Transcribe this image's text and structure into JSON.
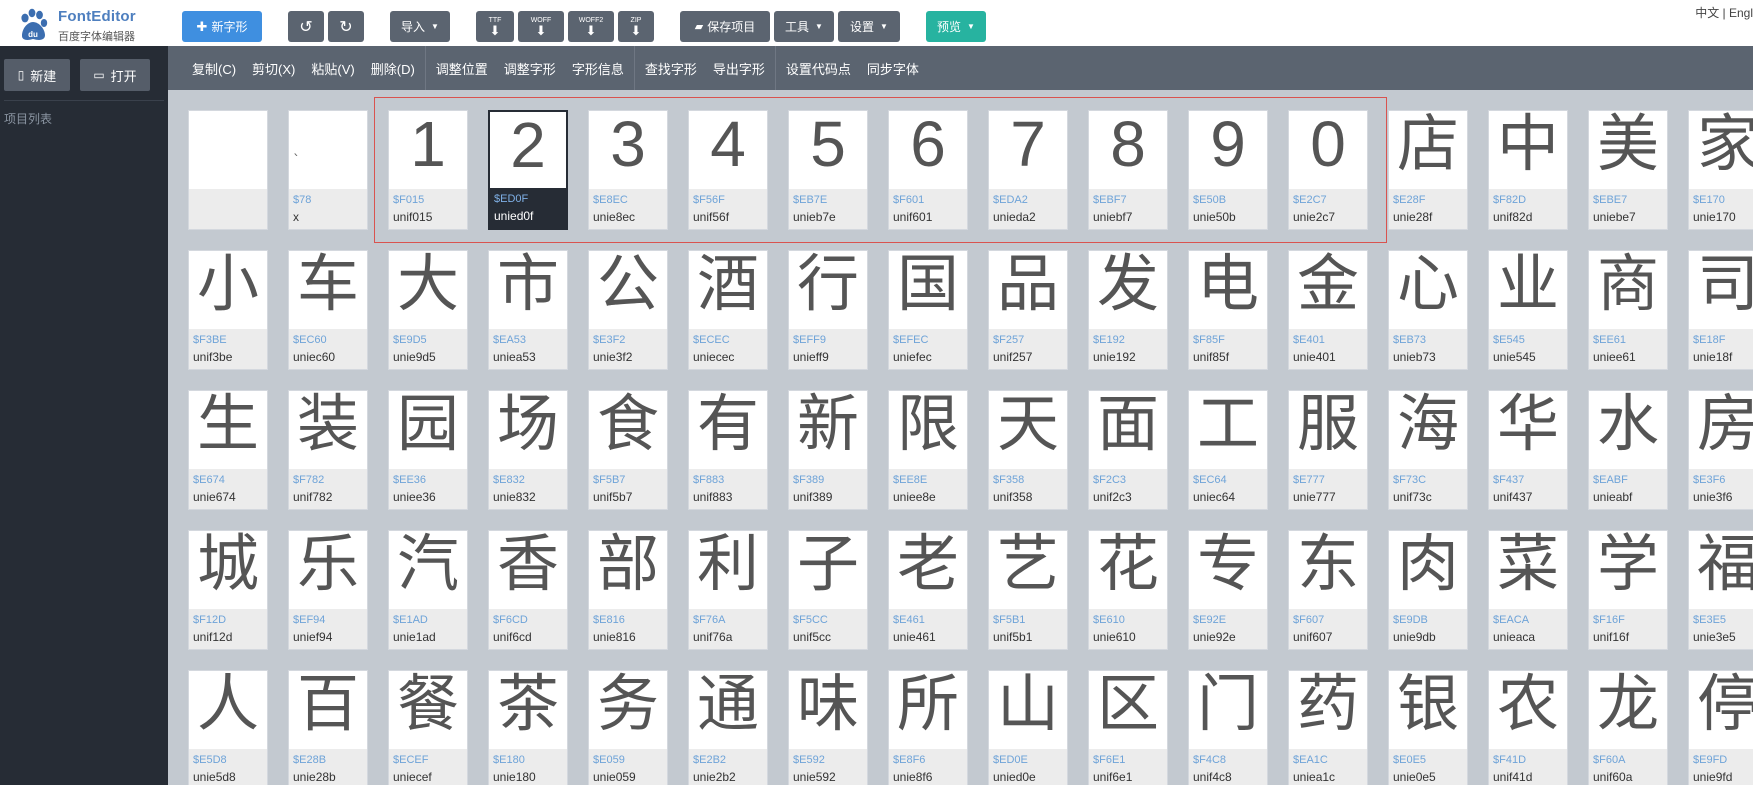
{
  "header": {
    "logo_title": "FontEditor",
    "logo_sub": "百度字体编辑器",
    "buttons": {
      "new_glyph": "新字形",
      "import": "导入",
      "ttf": "TTF",
      "woff": "WOFF",
      "woff2": "WOFF2",
      "zip": "ZIP",
      "save": "保存项目",
      "tools": "工具",
      "settings": "设置",
      "preview": "预览"
    },
    "lang": "中文 | Engl"
  },
  "sidebar": {
    "new_label": "新建",
    "open_label": "打开",
    "project_list": "项目列表"
  },
  "toolbar": {
    "copy": "复制(C)",
    "cut": "剪切(X)",
    "paste": "粘贴(V)",
    "delete": "删除(D)",
    "adjust_pos": "调整位置",
    "adjust_glyph": "调整字形",
    "glyph_info": "字形信息",
    "find_glyph": "查找字形",
    "export_glyph": "导出字形",
    "set_codepoint": "设置代码点",
    "sync_font": "同步字体"
  },
  "glyphs": [
    {
      "g": "",
      "code": "",
      "name": ""
    },
    {
      "g": "`",
      "code": "$78",
      "name": "x"
    },
    {
      "g": "1",
      "code": "$F015",
      "name": "unif015"
    },
    {
      "g": "2",
      "code": "$ED0F",
      "name": "unied0f"
    },
    {
      "g": "3",
      "code": "$E8EC",
      "name": "unie8ec"
    },
    {
      "g": "4",
      "code": "$F56F",
      "name": "unif56f"
    },
    {
      "g": "5",
      "code": "$EB7E",
      "name": "unieb7e"
    },
    {
      "g": "6",
      "code": "$F601",
      "name": "unif601"
    },
    {
      "g": "7",
      "code": "$EDA2",
      "name": "unieda2"
    },
    {
      "g": "8",
      "code": "$EBF7",
      "name": "uniebf7"
    },
    {
      "g": "9",
      "code": "$E50B",
      "name": "unie50b"
    },
    {
      "g": "0",
      "code": "$E2C7",
      "name": "unie2c7"
    },
    {
      "g": "店",
      "code": "$E28F",
      "name": "unie28f"
    },
    {
      "g": "中",
      "code": "$F82D",
      "name": "unif82d"
    },
    {
      "g": "美",
      "code": "$EBE7",
      "name": "uniebe7"
    },
    {
      "g": "家",
      "code": "$E170",
      "name": "unie170"
    },
    {
      "g": "小",
      "code": "$F3BE",
      "name": "unif3be"
    },
    {
      "g": "车",
      "code": "$EC60",
      "name": "uniec60"
    },
    {
      "g": "大",
      "code": "$E9D5",
      "name": "unie9d5"
    },
    {
      "g": "市",
      "code": "$EA53",
      "name": "uniea53"
    },
    {
      "g": "公",
      "code": "$E3F2",
      "name": "unie3f2"
    },
    {
      "g": "酒",
      "code": "$ECEC",
      "name": "uniecec"
    },
    {
      "g": "行",
      "code": "$EFF9",
      "name": "unieff9"
    },
    {
      "g": "国",
      "code": "$EFEC",
      "name": "uniefec"
    },
    {
      "g": "品",
      "code": "$F257",
      "name": "unif257"
    },
    {
      "g": "发",
      "code": "$E192",
      "name": "unie192"
    },
    {
      "g": "电",
      "code": "$F85F",
      "name": "unif85f"
    },
    {
      "g": "金",
      "code": "$E401",
      "name": "unie401"
    },
    {
      "g": "心",
      "code": "$EB73",
      "name": "unieb73"
    },
    {
      "g": "业",
      "code": "$E545",
      "name": "unie545"
    },
    {
      "g": "商",
      "code": "$EE61",
      "name": "uniee61"
    },
    {
      "g": "司",
      "code": "$E18F",
      "name": "unie18f"
    },
    {
      "g": "生",
      "code": "$E674",
      "name": "unie674"
    },
    {
      "g": "装",
      "code": "$F782",
      "name": "unif782"
    },
    {
      "g": "园",
      "code": "$EE36",
      "name": "uniee36"
    },
    {
      "g": "场",
      "code": "$E832",
      "name": "unie832"
    },
    {
      "g": "食",
      "code": "$F5B7",
      "name": "unif5b7"
    },
    {
      "g": "有",
      "code": "$F883",
      "name": "unif883"
    },
    {
      "g": "新",
      "code": "$F389",
      "name": "unif389"
    },
    {
      "g": "限",
      "code": "$EE8E",
      "name": "uniee8e"
    },
    {
      "g": "天",
      "code": "$F358",
      "name": "unif358"
    },
    {
      "g": "面",
      "code": "$F2C3",
      "name": "unif2c3"
    },
    {
      "g": "工",
      "code": "$EC64",
      "name": "uniec64"
    },
    {
      "g": "服",
      "code": "$E777",
      "name": "unie777"
    },
    {
      "g": "海",
      "code": "$F73C",
      "name": "unif73c"
    },
    {
      "g": "华",
      "code": "$F437",
      "name": "unif437"
    },
    {
      "g": "水",
      "code": "$EABF",
      "name": "unieabf"
    },
    {
      "g": "房",
      "code": "$E3F6",
      "name": "unie3f6"
    },
    {
      "g": "城",
      "code": "$F12D",
      "name": "unif12d"
    },
    {
      "g": "乐",
      "code": "$EF94",
      "name": "unief94"
    },
    {
      "g": "汽",
      "code": "$E1AD",
      "name": "unie1ad"
    },
    {
      "g": "香",
      "code": "$F6CD",
      "name": "unif6cd"
    },
    {
      "g": "部",
      "code": "$E816",
      "name": "unie816"
    },
    {
      "g": "利",
      "code": "$F76A",
      "name": "unif76a"
    },
    {
      "g": "子",
      "code": "$F5CC",
      "name": "unif5cc"
    },
    {
      "g": "老",
      "code": "$E461",
      "name": "unie461"
    },
    {
      "g": "艺",
      "code": "$F5B1",
      "name": "unif5b1"
    },
    {
      "g": "花",
      "code": "$E610",
      "name": "unie610"
    },
    {
      "g": "专",
      "code": "$E92E",
      "name": "unie92e"
    },
    {
      "g": "东",
      "code": "$F607",
      "name": "unif607"
    },
    {
      "g": "肉",
      "code": "$E9DB",
      "name": "unie9db"
    },
    {
      "g": "菜",
      "code": "$EACA",
      "name": "unieaca"
    },
    {
      "g": "学",
      "code": "$F16F",
      "name": "unif16f"
    },
    {
      "g": "福",
      "code": "$E3E5",
      "name": "unie3e5"
    },
    {
      "g": "人",
      "code": "$E5D8",
      "name": "unie5d8"
    },
    {
      "g": "百",
      "code": "$E28B",
      "name": "unie28b"
    },
    {
      "g": "餐",
      "code": "$ECEF",
      "name": "uniecef"
    },
    {
      "g": "茶",
      "code": "$E180",
      "name": "unie180"
    },
    {
      "g": "务",
      "code": "$E059",
      "name": "unie059"
    },
    {
      "g": "通",
      "code": "$E2B2",
      "name": "unie2b2"
    },
    {
      "g": "味",
      "code": "$E592",
      "name": "unie592"
    },
    {
      "g": "所",
      "code": "$E8F6",
      "name": "unie8f6"
    },
    {
      "g": "山",
      "code": "$ED0E",
      "name": "unied0e"
    },
    {
      "g": "区",
      "code": "$F6E1",
      "name": "unif6e1"
    },
    {
      "g": "门",
      "code": "$F4C8",
      "name": "unif4c8"
    },
    {
      "g": "药",
      "code": "$EA1C",
      "name": "uniea1c"
    },
    {
      "g": "银",
      "code": "$E0E5",
      "name": "unie0e5"
    },
    {
      "g": "农",
      "code": "$F41D",
      "name": "unif41d"
    },
    {
      "g": "龙",
      "code": "$F60A",
      "name": "unif60a"
    },
    {
      "g": "停",
      "code": "$E9FD",
      "name": "unie9fd"
    }
  ],
  "selected_code": "$ED0F",
  "colors": {
    "accent_blue": "#3f8fe0",
    "preview_teal": "#27b3a0",
    "sidebar": "#262c35",
    "toolbar": "#5b6470",
    "selection_box": "#d9534f"
  }
}
